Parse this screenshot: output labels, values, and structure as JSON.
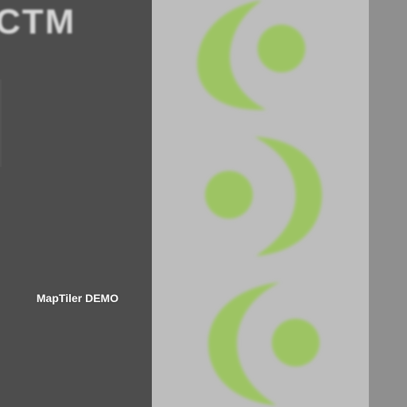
{
  "map": {
    "watermark": "MapTiler DEMO",
    "top_label_fragment": "CTM"
  },
  "colors": {
    "dark_band": "#4d4d4d",
    "light_band": "#bdbdbd",
    "right_band": "#8f8f8f",
    "logo_green": "#9dc463",
    "label_text": "#ffffff"
  },
  "icons": [
    "moon-dot-logo-icon",
    "moon-dot-logo-icon",
    "moon-dot-logo-icon"
  ]
}
